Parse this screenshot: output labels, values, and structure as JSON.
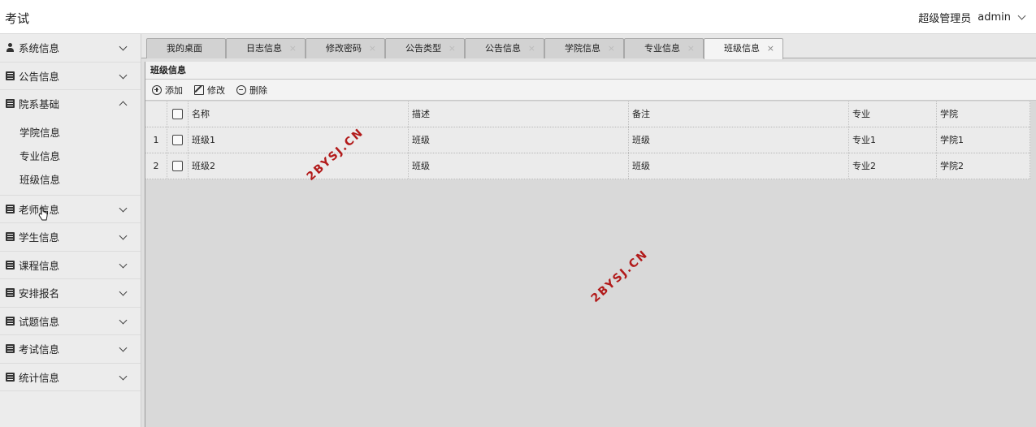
{
  "app": {
    "title": "考试"
  },
  "user": {
    "role": "超级管理员",
    "name": "admin"
  },
  "sidebar": {
    "groups": [
      {
        "label": "系统信息",
        "icon": "user-icon",
        "expanded": false
      },
      {
        "label": "公告信息",
        "icon": "book-icon",
        "expanded": false
      },
      {
        "label": "院系基础",
        "icon": "book-icon",
        "expanded": true,
        "children": [
          "学院信息",
          "专业信息",
          "班级信息"
        ]
      },
      {
        "label": "老师信息",
        "icon": "book-icon",
        "expanded": false
      },
      {
        "label": "学生信息",
        "icon": "book-icon",
        "expanded": false
      },
      {
        "label": "课程信息",
        "icon": "book-icon",
        "expanded": false
      },
      {
        "label": "安排报名",
        "icon": "book-icon",
        "expanded": false
      },
      {
        "label": "试题信息",
        "icon": "book-icon",
        "expanded": false
      },
      {
        "label": "考试信息",
        "icon": "book-icon",
        "expanded": false
      },
      {
        "label": "统计信息",
        "icon": "book-icon",
        "expanded": false
      }
    ]
  },
  "tabs": [
    {
      "label": "我的桌面"
    },
    {
      "label": "日志信息"
    },
    {
      "label": "修改密码"
    },
    {
      "label": "公告类型"
    },
    {
      "label": "公告信息"
    },
    {
      "label": "学院信息"
    },
    {
      "label": "专业信息"
    },
    {
      "label": "班级信息",
      "active": true
    }
  ],
  "panel": {
    "title": "班级信息",
    "toolbar": {
      "add": "添加",
      "edit": "修改",
      "delete": "删除"
    }
  },
  "table": {
    "columns": [
      "名称",
      "描述",
      "备注",
      "专业",
      "学院"
    ],
    "rows": [
      {
        "num": "1",
        "name": "班级1",
        "desc": "班级",
        "note": "班级",
        "major": "专业1",
        "college": "学院1"
      },
      {
        "num": "2",
        "name": "班级2",
        "desc": "班级",
        "note": "班级",
        "major": "专业2",
        "college": "学院2"
      }
    ]
  },
  "watermark": "2BYSJ.CN",
  "colors": {
    "watermark": "#b21a1a",
    "panel_bg": "#d9d9d9"
  }
}
